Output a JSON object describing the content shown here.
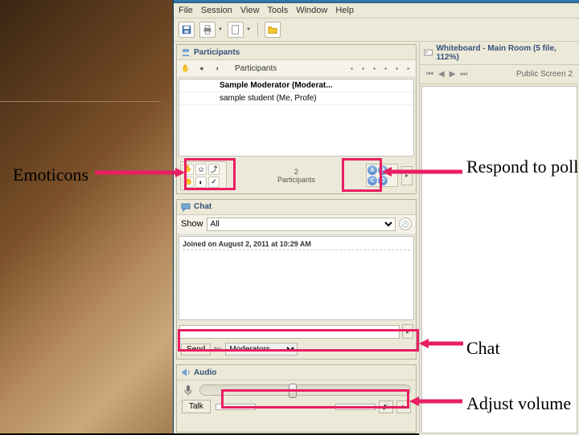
{
  "menubar": {
    "file": "File",
    "session": "Session",
    "view": "View",
    "tools": "Tools",
    "window": "Window",
    "help": "Help"
  },
  "panels": {
    "participants": {
      "title": "Participants",
      "column_label": "Participants",
      "rows": [
        "Sample Moderator (Moderat...",
        "sample student (Me, Profe)"
      ],
      "count_number": "2",
      "count_label": "Participants",
      "poll_options": [
        "A",
        "B",
        "C",
        "D"
      ]
    },
    "chat": {
      "title": "Chat",
      "show_label": "Show",
      "show_value": "All",
      "message": "Joined on August 2, 2011 at 10:29 AM",
      "send_label": "Send",
      "to_label": "to:",
      "to_value": "Moderators"
    },
    "audio": {
      "title": "Audio",
      "talk_label": "Talk"
    },
    "whiteboard": {
      "title": "Whiteboard - Main Room (5 file, 112%)",
      "screen_label": "Public Screen 2"
    }
  },
  "annotations": {
    "emoticons": "Emoticons",
    "respond": "Respond to poll",
    "chat": "Chat",
    "volume": "Adjust volume"
  },
  "colors": {
    "highlight": "#e91e63"
  }
}
